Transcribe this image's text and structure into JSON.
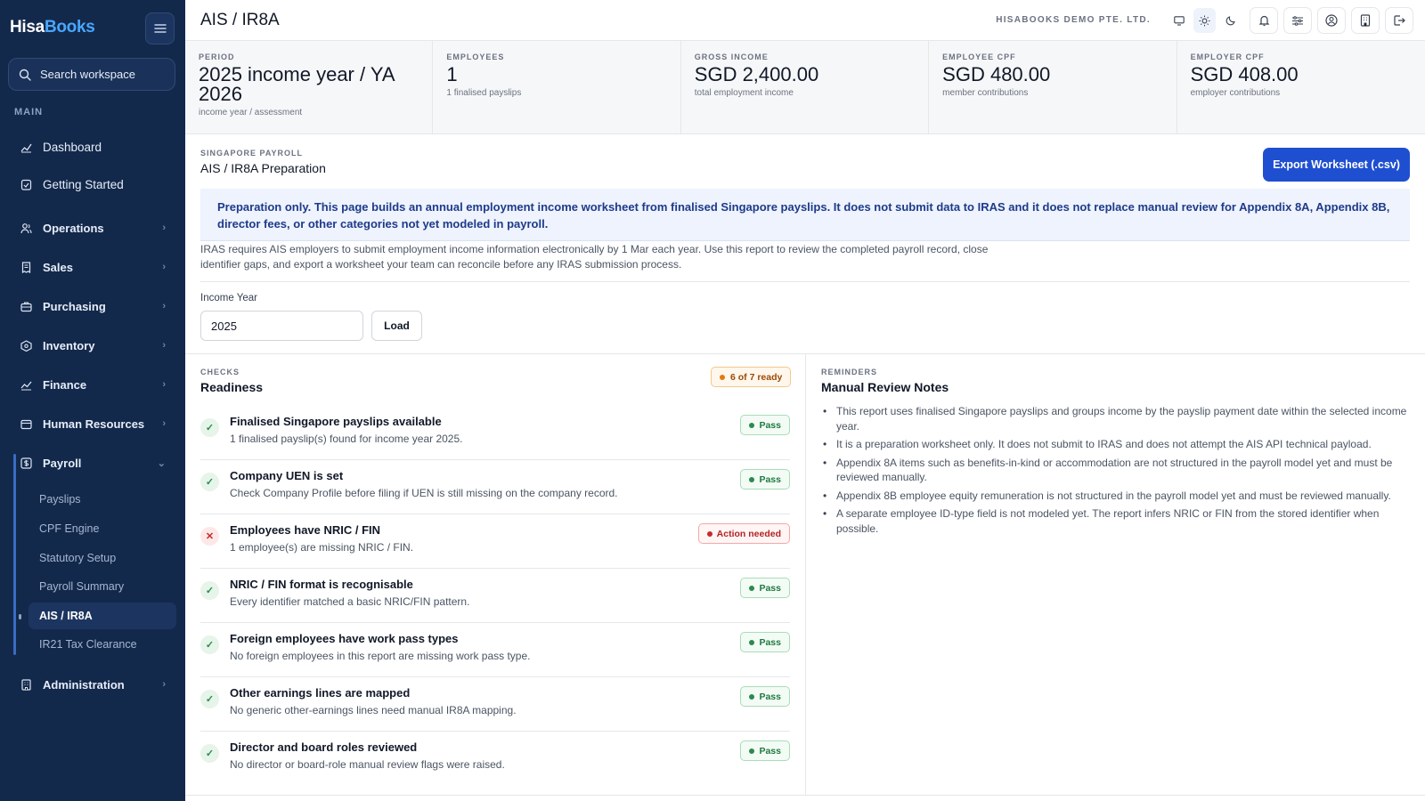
{
  "app": {
    "logo_part1": "Hisa",
    "logo_part2": "Books",
    "company": "HISABOOKS DEMO PTE. LTD.",
    "page_title": "AIS / IR8A"
  },
  "sidebar": {
    "search_placeholder": "Search workspace",
    "section_label": "MAIN",
    "top_items": [
      {
        "label": "Dashboard",
        "icon": "chart-line-icon"
      },
      {
        "label": "Getting Started",
        "icon": "clipboard-check-icon"
      }
    ],
    "groups": [
      {
        "label": "Operations",
        "icon": "users-icon"
      },
      {
        "label": "Sales",
        "icon": "receipt-icon"
      },
      {
        "label": "Purchasing",
        "icon": "briefcase-icon"
      },
      {
        "label": "Inventory",
        "icon": "box-icon"
      },
      {
        "label": "Finance",
        "icon": "chart-icon"
      },
      {
        "label": "Human Resources",
        "icon": "id-card-icon"
      },
      {
        "label": "Payroll",
        "icon": "payroll-icon"
      },
      {
        "label": "Administration",
        "icon": "building-icon"
      }
    ],
    "payroll_sub": [
      "Payslips",
      "CPF Engine",
      "Statutory Setup",
      "Payroll Summary",
      "AIS / IR8A",
      "IR21 Tax Clearance"
    ],
    "active_sub": "AIS / IR8A"
  },
  "stats": [
    {
      "label": "PERIOD",
      "value": "2025 income year / YA 2026",
      "sub": "income year / assessment"
    },
    {
      "label": "EMPLOYEES",
      "value": "1",
      "sub": "1 finalised payslips"
    },
    {
      "label": "GROSS INCOME",
      "value": "SGD 2,400.00",
      "sub": "total employment income"
    },
    {
      "label": "EMPLOYEE CPF",
      "value": "SGD 480.00",
      "sub": "member contributions"
    },
    {
      "label": "EMPLOYER CPF",
      "value": "SGD 408.00",
      "sub": "employer contributions"
    }
  ],
  "prep": {
    "eyebrow": "SINGAPORE PAYROLL",
    "title": "AIS / IR8A Preparation",
    "export_label": "Export Worksheet (.csv)",
    "notice": "Preparation only. This page builds an annual employment income worksheet from finalised Singapore payslips. It does not submit data to IRAS and it does not replace manual review for Appendix 8A, Appendix 8B, director fees, or other categories not yet modeled in payroll.",
    "intro": "IRAS requires AIS employers to submit employment income information electronically by 1 Mar each year. Use this report to review the completed payroll record, close identifier gaps, and export a worksheet your team can reconcile before any IRAS submission process.",
    "year_label": "Income Year",
    "year_value": "2025",
    "load_label": "Load"
  },
  "checks": {
    "eyebrow": "CHECKS",
    "title": "Readiness",
    "summary": "6 of 7 ready",
    "items": [
      {
        "title": "Finalised Singapore payslips available",
        "desc": "1 finalised payslip(s) found for income year 2025.",
        "status": "Pass",
        "ok": true
      },
      {
        "title": "Company UEN is set",
        "desc": "Check Company Profile before filing if UEN is still missing on the company record.",
        "status": "Pass",
        "ok": true
      },
      {
        "title": "Employees have NRIC / FIN",
        "desc": "1 employee(s) are missing NRIC / FIN.",
        "status": "Action needed",
        "ok": false
      },
      {
        "title": "NRIC / FIN format is recognisable",
        "desc": "Every identifier matched a basic NRIC/FIN pattern.",
        "status": "Pass",
        "ok": true
      },
      {
        "title": "Foreign employees have work pass types",
        "desc": "No foreign employees in this report are missing work pass type.",
        "status": "Pass",
        "ok": true
      },
      {
        "title": "Other earnings lines are mapped",
        "desc": "No generic other-earnings lines need manual IR8A mapping.",
        "status": "Pass",
        "ok": true
      },
      {
        "title": "Director and board roles reviewed",
        "desc": "No director or board-role manual review flags were raised.",
        "status": "Pass",
        "ok": true
      }
    ]
  },
  "reminders": {
    "eyebrow": "REMINDERS",
    "title": "Manual Review Notes",
    "items": [
      "This report uses finalised Singapore payslips and groups income by the payslip payment date within the selected income year.",
      "It is a preparation worksheet only. It does not submit to IRAS and does not attempt the AIS API technical payload.",
      "Appendix 8A items such as benefits-in-kind or accommodation are not structured in the payroll model yet and must be reviewed manually.",
      "Appendix 8B employee equity remuneration is not structured in the payroll model yet and must be reviewed manually.",
      "A separate employee ID-type field is not modeled yet. The report infers NRIC or FIN from the stored identifier when possible."
    ]
  },
  "colors": {
    "sidebar_bg": "#13294b",
    "accent": "#1f4fd1",
    "pass": "#1f7a3f",
    "action": "#b42323",
    "warning": "#9a4a07"
  }
}
